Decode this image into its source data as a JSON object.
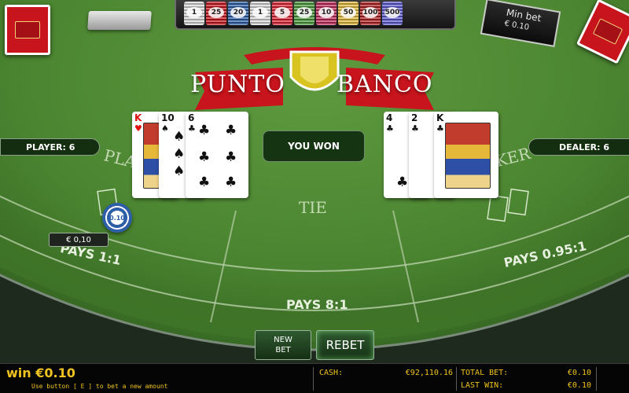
{
  "game": {
    "logo_left": "PUNTO",
    "logo_right": "BANCO",
    "min_bet_label": "Min bet",
    "min_bet_value": "€ 0.10"
  },
  "chip_tray": [
    "1",
    "25",
    "20",
    "1",
    "5",
    "25",
    "10",
    "50",
    "100",
    "500"
  ],
  "table": {
    "player_label_arc": "PLA",
    "banker_label_arc": "KER",
    "tie_label": "TIE",
    "pays_player": "PAYS 1:1",
    "pays_tie": "PAYS 8:1",
    "pays_banker": "PAYS 0.95:1"
  },
  "player": {
    "score_text": "PLAYER: 6",
    "cards": [
      {
        "rank": "K",
        "suit": "♥",
        "color": "red",
        "face": true
      },
      {
        "rank": "10",
        "suit": "♠",
        "color": "black",
        "face": false
      },
      {
        "rank": "6",
        "suit": "♣",
        "color": "black",
        "face": false
      }
    ],
    "bet_chip": "0.10",
    "bet_amount": "€ 0,10"
  },
  "dealer": {
    "score_text": "DEALER: 6",
    "cards": [
      {
        "rank": "4",
        "suit": "♣",
        "color": "black",
        "face": false
      },
      {
        "rank": "2",
        "suit": "♣",
        "color": "black",
        "face": false
      },
      {
        "rank": "K",
        "suit": "♣",
        "color": "black",
        "face": true
      }
    ]
  },
  "result": "YOU WON",
  "buttons": {
    "new_bet": "NEW\nBET",
    "rebet": "REBET"
  },
  "bottom_bar": {
    "win_label": "win €0.10",
    "hint": "Use button [ E ] to bet a new amount",
    "cash_label": "CASH:",
    "cash_value": "€92,110.16",
    "total_bet_label": "TOTAL BET:",
    "total_bet_value": "€0.10",
    "last_win_label": "LAST WIN:",
    "last_win_value": "€0.10"
  },
  "colors": {
    "felt": "#4f8a33",
    "felt_dark": "#2f5f20",
    "accent_gold": "#f0c420",
    "banner_red": "#c8141c"
  }
}
